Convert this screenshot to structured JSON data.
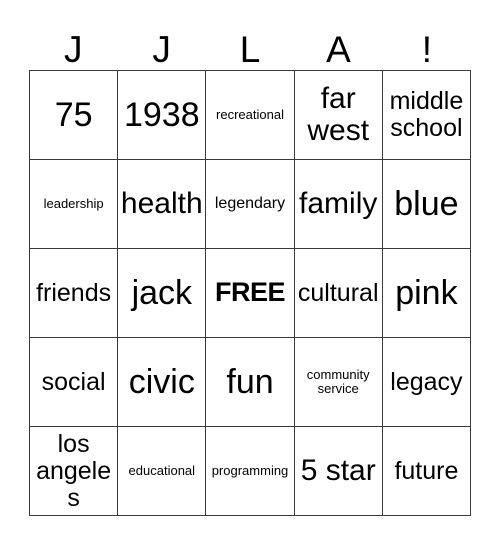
{
  "card": {
    "header_letters": [
      "J",
      "J",
      "L",
      "A",
      "!"
    ],
    "rows": [
      [
        {
          "text": "75",
          "size": "sz-xl"
        },
        {
          "text": "1938",
          "size": "sz-xl"
        },
        {
          "text": "recreational",
          "size": "sz-xs"
        },
        {
          "text": "far west",
          "size": "sz-lg"
        },
        {
          "text": "middle school",
          "size": "sz-md"
        }
      ],
      [
        {
          "text": "leadership",
          "size": "sz-xs"
        },
        {
          "text": "health",
          "size": "sz-lg"
        },
        {
          "text": "legendary",
          "size": "sz-sm"
        },
        {
          "text": "family",
          "size": "sz-lg"
        },
        {
          "text": "blue",
          "size": "sz-xl"
        }
      ],
      [
        {
          "text": "friends",
          "size": "sz-md"
        },
        {
          "text": "jack",
          "size": "sz-xl"
        },
        {
          "text": "FREE",
          "size": "free"
        },
        {
          "text": "cultural",
          "size": "sz-md"
        },
        {
          "text": "pink",
          "size": "sz-xl"
        }
      ],
      [
        {
          "text": "social",
          "size": "sz-md"
        },
        {
          "text": "civic",
          "size": "sz-xl"
        },
        {
          "text": "fun",
          "size": "sz-xl"
        },
        {
          "text": "community service",
          "size": "sz-xs"
        },
        {
          "text": "legacy",
          "size": "sz-md"
        }
      ],
      [
        {
          "text": "los angeles",
          "size": "sz-md"
        },
        {
          "text": "educational",
          "size": "sz-xs"
        },
        {
          "text": "programming",
          "size": "sz-xs"
        },
        {
          "text": "5 star",
          "size": "sz-lg"
        },
        {
          "text": "future",
          "size": "sz-md"
        }
      ]
    ]
  },
  "colors": {
    "border": "#3a3a3a",
    "text": "#000000",
    "background": "#ffffff"
  }
}
